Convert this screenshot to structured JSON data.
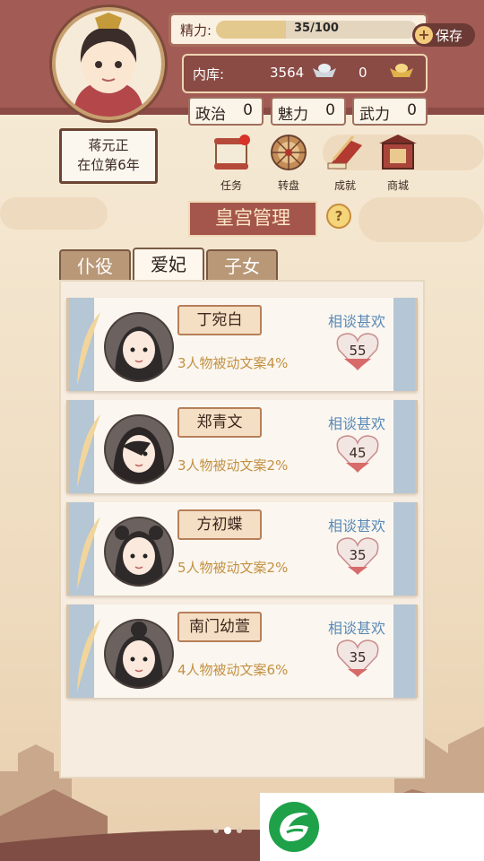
{
  "player": {
    "name": "蒋元正",
    "reign": "在位第6年",
    "energy_label": "精力:",
    "energy_text": "35/100",
    "energy_fraction": 0.35,
    "save_label": "保存"
  },
  "treasury": {
    "label": "内库:",
    "silver": "3564",
    "gold": "0"
  },
  "stats": [
    {
      "label": "政治",
      "value": "0"
    },
    {
      "label": "魅力",
      "value": "0"
    },
    {
      "label": "武力",
      "value": "0"
    }
  ],
  "menu": [
    {
      "label": "任务",
      "icon": "scroll-task-icon"
    },
    {
      "label": "转盘",
      "icon": "wheel-icon"
    },
    {
      "label": "成就",
      "icon": "achievement-icon"
    },
    {
      "label": "商城",
      "icon": "shop-icon"
    }
  ],
  "section_title": "皇宫管理",
  "help_label": "?",
  "tabs": [
    {
      "label": "仆役",
      "active": false
    },
    {
      "label": "爱妃",
      "active": true
    },
    {
      "label": "子女",
      "active": false
    }
  ],
  "consorts": [
    {
      "name": "丁宛白",
      "desc": "3人物被动文案4%",
      "relation": "相谈甚欢",
      "favor": "55"
    },
    {
      "name": "郑青文",
      "desc": "3人物被动文案2%",
      "relation": "相谈甚欢",
      "favor": "45"
    },
    {
      "name": "方初蝶",
      "desc": "5人物被动文案2%",
      "relation": "相谈甚欢",
      "favor": "35"
    },
    {
      "name": "南门幼萱",
      "desc": "4人物被动文案6%",
      "relation": "相谈甚欢",
      "favor": "35"
    }
  ],
  "pager": {
    "count": 3,
    "active_index": 1
  },
  "colors": {
    "header_bg": "#a35b55",
    "accent_red": "#a5564c",
    "relation_blue": "#5a88b6",
    "desc_gold": "#c39042",
    "logo_green": "#1fa14a"
  }
}
